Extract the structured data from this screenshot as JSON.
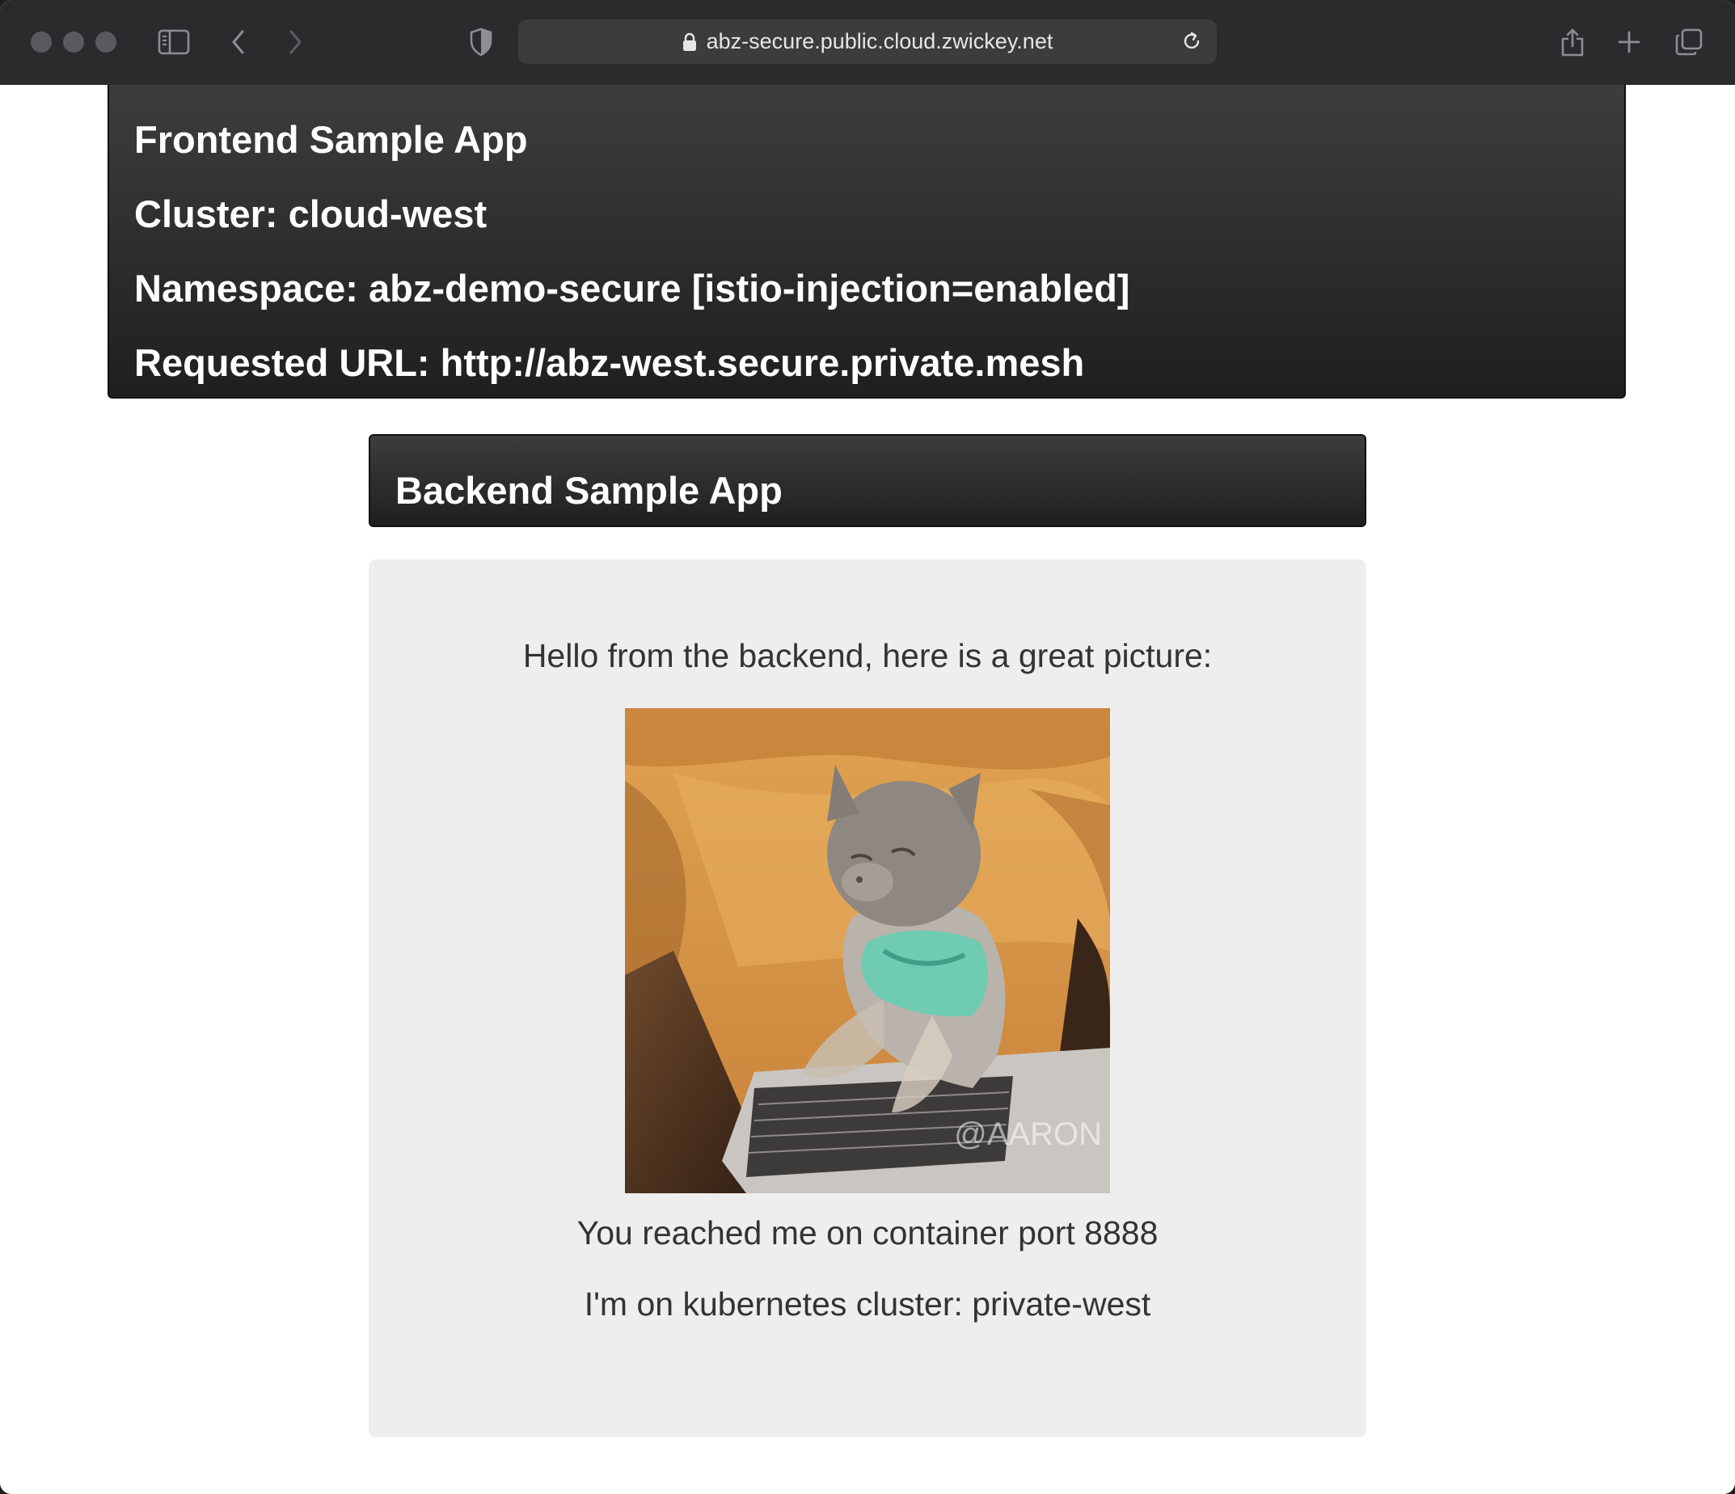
{
  "browser": {
    "url": "abz-secure.public.cloud.zwickey.net",
    "icons": {
      "sidebar": "sidebar-icon",
      "back": "chevron-left-icon",
      "forward": "chevron-right-icon",
      "privacy": "shield-icon",
      "lock": "lock-icon",
      "reload": "reload-icon",
      "share": "share-icon",
      "new_tab": "plus-icon",
      "tab_overview": "tabs-icon"
    }
  },
  "frontend": {
    "title": "Frontend Sample App",
    "cluster": "Cluster: cloud-west",
    "namespace": "Namespace: abz-demo-secure [istio-injection=enabled]",
    "requested_url": "Requested URL: http://abz-west.secure.private.mesh"
  },
  "backend": {
    "title": "Backend Sample App",
    "greeting": "Hello from the backend, here is a great picture:",
    "picture_watermark": "@AARON",
    "port_message": "You reached me on container port 8888",
    "cluster_message": "I'm on kubernetes cluster: private-west"
  },
  "colors": {
    "toolbar": "#2b2b2e",
    "header_gradient_top": "#3d3d3f",
    "header_gradient_bottom": "#1f1f20",
    "panel": "#eeeeee"
  }
}
